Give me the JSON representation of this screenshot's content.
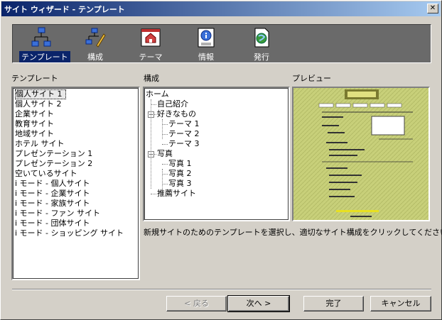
{
  "window": {
    "title": "サイト ウィザード - テンプレート",
    "close_glyph": "✕"
  },
  "toolbar": {
    "items": [
      {
        "label": "テンプレート",
        "icon": "template-icon",
        "active": true
      },
      {
        "label": "構成",
        "icon": "structure-icon",
        "active": false
      },
      {
        "label": "テーマ",
        "icon": "theme-icon",
        "active": false
      },
      {
        "label": "情報",
        "icon": "info-icon",
        "active": false
      },
      {
        "label": "発行",
        "icon": "publish-icon",
        "active": false
      }
    ]
  },
  "sections": {
    "template": "テンプレート",
    "structure": "構成",
    "preview": "プレビュー"
  },
  "templates": {
    "selected_index": 0,
    "items": [
      "個人サイト 1",
      "個人サイト 2",
      "企業サイト",
      "教育サイト",
      "地域サイト",
      "ホテル サイト",
      "プレゼンテーション 1",
      "プレゼンテーション 2",
      "空いているサイト",
      "i モード - 個人サイト",
      "i モード - 企業サイト",
      "i モード - 家族サイト",
      "i モード - ファン サイト",
      "i モード - 団体サイト",
      "i モード - ショッピング サイト"
    ]
  },
  "structure": {
    "nodes": [
      {
        "label": "ホーム",
        "level": 0,
        "expander": ""
      },
      {
        "label": "自己紹介",
        "level": 1,
        "expander": ""
      },
      {
        "label": "好きなもの",
        "level": 1,
        "expander": "−"
      },
      {
        "label": "テーマ 1",
        "level": 2,
        "expander": ""
      },
      {
        "label": "テーマ 2",
        "level": 2,
        "expander": ""
      },
      {
        "label": "テーマ 3",
        "level": 2,
        "expander": ""
      },
      {
        "label": "写真",
        "level": 1,
        "expander": "−"
      },
      {
        "label": "写真 1",
        "level": 2,
        "expander": ""
      },
      {
        "label": "写真 2",
        "level": 2,
        "expander": ""
      },
      {
        "label": "写真 3",
        "level": 2,
        "expander": ""
      },
      {
        "label": "推薦サイト",
        "level": 1,
        "expander": ""
      }
    ]
  },
  "description": "新規サイトのためのテンプレートを選択し、適切なサイト構成をクリックしてください。",
  "buttons": {
    "back": "< 戻る",
    "next": "次へ >",
    "finish": "完了",
    "cancel": "キャンセル"
  },
  "colors": {
    "titlebar": "#0a246a",
    "toolbar_bg": "#6a6a6a",
    "preview_bg": "#c8d07a",
    "face": "#d4d0c8"
  }
}
